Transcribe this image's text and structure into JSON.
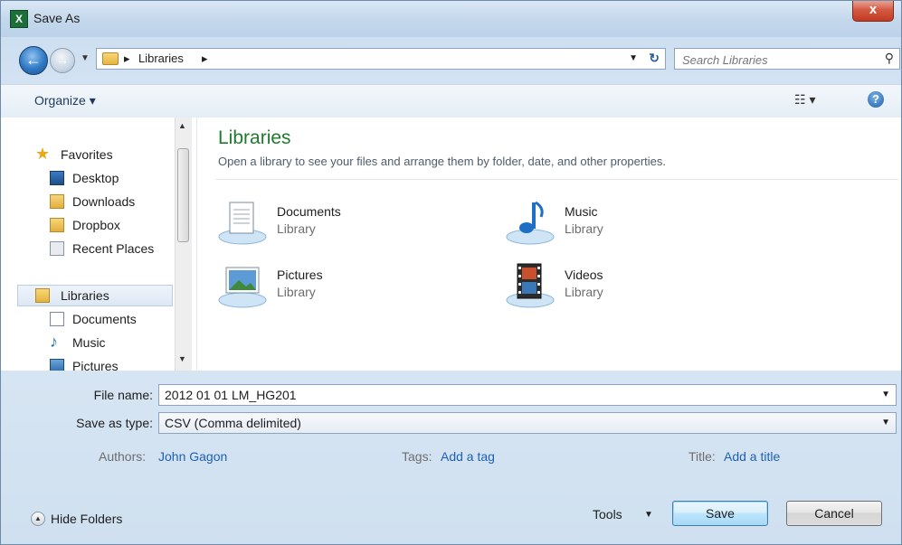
{
  "window": {
    "title": "Save As",
    "close_symbol": "x"
  },
  "nav": {
    "back_symbol": "←",
    "forward_symbol": "→",
    "breadcrumb": [
      "Libraries"
    ],
    "search_placeholder": "Search Libraries"
  },
  "toolbar": {
    "organize_label": "Organize",
    "help_symbol": "?"
  },
  "sidebar": {
    "favorites_header": "Favorites",
    "favorites": [
      "Desktop",
      "Downloads",
      "Dropbox",
      "Recent Places"
    ],
    "libraries_header": "Libraries",
    "libraries": [
      "Documents",
      "Music",
      "Pictures"
    ]
  },
  "content": {
    "title": "Libraries",
    "description": "Open a library to see your files and arrange them by folder, date, and other properties.",
    "items": [
      {
        "name": "Documents",
        "type": "Library"
      },
      {
        "name": "Music",
        "type": "Library"
      },
      {
        "name": "Pictures",
        "type": "Library"
      },
      {
        "name": "Videos",
        "type": "Library"
      }
    ]
  },
  "form": {
    "filename_label": "File name:",
    "filename_value": "2012 01 01 LM_HG201",
    "savetype_label": "Save as type:",
    "savetype_value": "CSV (Comma delimited)",
    "authors_label": "Authors:",
    "authors_value": "John Gagon",
    "tags_label": "Tags:",
    "tags_value": "Add a tag",
    "title_label": "Title:",
    "title_value": "Add a title"
  },
  "footer": {
    "hide_folders_label": "Hide Folders",
    "tools_label": "Tools",
    "save_label": "Save",
    "cancel_label": "Cancel"
  },
  "colors": {
    "accent_green": "#1e7a2c",
    "link_blue": "#1e61b0",
    "close_red": "#c33a22"
  }
}
